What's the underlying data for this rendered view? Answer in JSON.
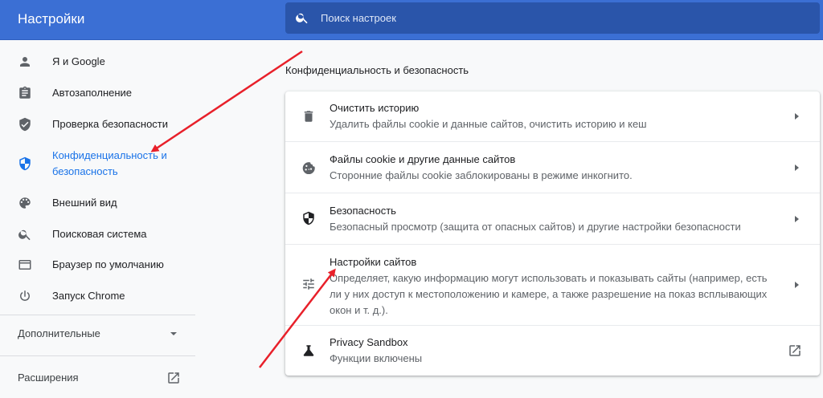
{
  "header": {
    "title": "Настройки",
    "search_placeholder": "Поиск настроек"
  },
  "sidebar": {
    "items": [
      {
        "label": "Я и Google",
        "icon": "person-icon"
      },
      {
        "label": "Автозаполнение",
        "icon": "clipboard-icon"
      },
      {
        "label": "Проверка безопасности",
        "icon": "shield-check-icon"
      },
      {
        "label_line1": "Конфиденциальность и",
        "label_line2": "безопасность",
        "icon": "shield-icon",
        "active": true
      },
      {
        "label": "Внешний вид",
        "icon": "palette-icon"
      },
      {
        "label": "Поисковая система",
        "icon": "search-icon"
      },
      {
        "label": "Браузер по умолчанию",
        "icon": "browser-icon"
      },
      {
        "label": "Запуск Chrome",
        "icon": "power-icon"
      }
    ],
    "advanced_label": "Дополнительные",
    "extensions_label": "Расширения"
  },
  "main": {
    "section_title": "Конфиденциальность и безопасность",
    "rows": [
      {
        "title": "Очистить историю",
        "subtitle": "Удалить файлы cookie и данные сайтов, очистить историю и кеш",
        "icon": "trash-icon"
      },
      {
        "title": "Файлы cookie и другие данные сайтов",
        "subtitle": "Сторонние файлы cookie заблокированы в режиме инкогнито.",
        "icon": "cookie-icon"
      },
      {
        "title": "Безопасность",
        "subtitle": "Безопасный просмотр (защита от опасных сайтов) и другие настройки безопасности",
        "icon": "security-shield-icon"
      },
      {
        "title": "Настройки сайтов",
        "subtitle_line1": "Определяет, какую информацию могут использовать и показывать сайты (например, есть",
        "subtitle_line2": "ли у них доступ к местоположению и камере, а также разрешение на показ всплывающих",
        "subtitle_line3": "окон и т. д.).",
        "icon": "tune-icon"
      },
      {
        "title": "Privacy Sandbox",
        "subtitle": "Функции включены",
        "icon": "flask-icon"
      }
    ]
  },
  "colors": {
    "header": "#3b6fd4",
    "search_bg": "#2a55aa",
    "accent": "#1a73e8",
    "annotation": "#e8202a"
  }
}
